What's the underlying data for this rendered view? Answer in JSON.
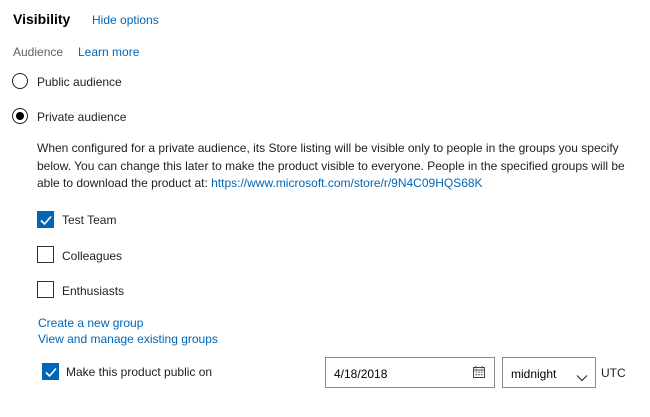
{
  "visibility": {
    "title": "Visibility",
    "hide_options_link": "Hide options",
    "audience_label": "Audience",
    "learn_more_link": "Learn more",
    "public_option": "Public audience",
    "private_option": "Private audience",
    "selected_option": "Private audience",
    "description_text": "When configured for a private audience, its Store listing will be visible only to people in the groups you specify below. You can change this later to make the product visible to everyone. People in the specified groups will be able to download the product at: ",
    "store_url": "https://www.microsoft.com/store/r/9N4C09HQS68K"
  },
  "groups": [
    {
      "label": "Test Team",
      "checked": true
    },
    {
      "label": "Colleagues",
      "checked": false
    },
    {
      "label": "Enthusiasts",
      "checked": false
    }
  ],
  "group_links": {
    "create": "Create a new group",
    "manage": "View and manage existing groups"
  },
  "schedule": {
    "make_public_label": "Make this product public on",
    "make_public_checked": true,
    "date_value": "4/18/2018",
    "time_value": "midnight",
    "timezone": "UTC"
  },
  "colors": {
    "accent": "#0067b8",
    "text": "#1f1f1f",
    "muted": "#5f5f5f"
  },
  "icons": [
    "radio-button",
    "checkbox",
    "calendar-icon",
    "chevron-down-icon"
  ]
}
